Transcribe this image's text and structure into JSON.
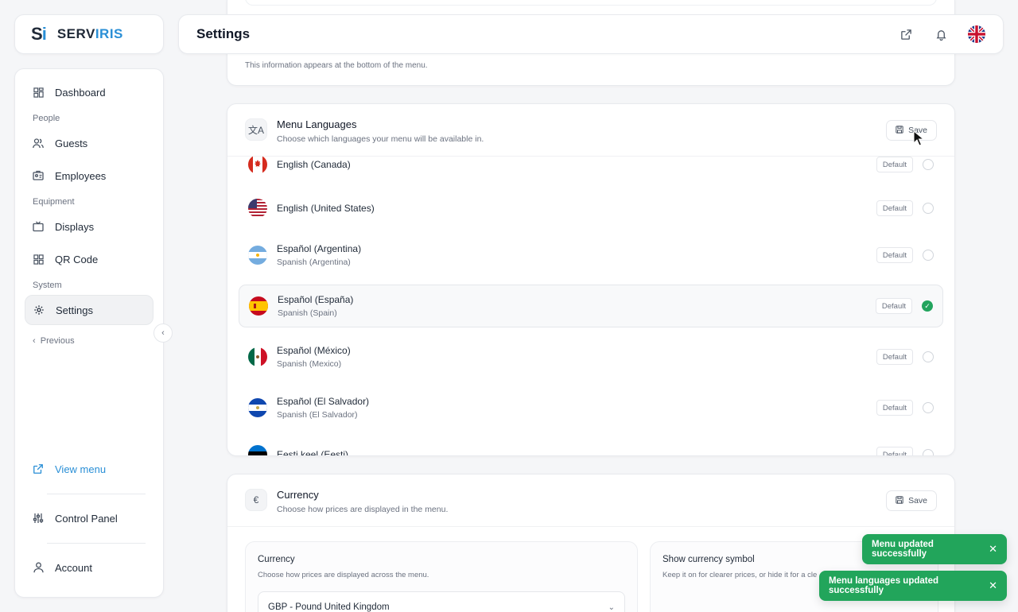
{
  "brand": {
    "mark_s": "S",
    "mark_i": "i",
    "name_part1": "SERV",
    "name_part2": "IRIS"
  },
  "header": {
    "title": "Settings"
  },
  "sidebar": {
    "items": [
      {
        "label": "Dashboard",
        "icon": "dashboard-icon"
      },
      {
        "section": "People"
      },
      {
        "label": "Guests",
        "icon": "guests-icon"
      },
      {
        "label": "Employees",
        "icon": "employees-icon"
      },
      {
        "section": "Equipment"
      },
      {
        "label": "Displays",
        "icon": "displays-icon"
      },
      {
        "label": "QR Code",
        "icon": "qr-code-icon"
      },
      {
        "section": "System"
      },
      {
        "label": "Settings",
        "icon": "gear-icon",
        "active": true
      }
    ],
    "previous": "Previous",
    "bottom": {
      "view_menu": "View menu",
      "control_panel": "Control Panel",
      "account": "Account"
    }
  },
  "info_card": {
    "note": "This information appears at the bottom of the menu."
  },
  "languages": {
    "icon_glyph": "文A",
    "title": "Menu Languages",
    "subtitle": "Choose which languages your menu will be available in.",
    "save_label": "Save",
    "default_label": "Default",
    "rows": [
      {
        "name": "English (Canada)",
        "sub": "",
        "flag": "ca",
        "selected": false
      },
      {
        "name": "English (United States)",
        "sub": "",
        "flag": "us",
        "selected": false
      },
      {
        "name": "Español (Argentina)",
        "sub": "Spanish (Argentina)",
        "flag": "ar",
        "selected": false
      },
      {
        "name": "Español (España)",
        "sub": "Spanish (Spain)",
        "flag": "es",
        "selected": true
      },
      {
        "name": "Español (México)",
        "sub": "Spanish (Mexico)",
        "flag": "mx",
        "selected": false
      },
      {
        "name": "Español (El Salvador)",
        "sub": "Spanish (El Salvador)",
        "flag": "sv",
        "selected": false
      },
      {
        "name": "Eesti keel (Eesti)",
        "sub": "",
        "flag": "ee",
        "selected": false
      }
    ]
  },
  "currency": {
    "icon_glyph": "€",
    "title": "Currency",
    "subtitle": "Choose how prices are displayed in the menu.",
    "save_label": "Save",
    "panel_currency": {
      "title": "Currency",
      "desc": "Choose how prices are displayed across the menu.",
      "selected": "GBP - Pound United Kingdom"
    },
    "panel_symbol": {
      "title": "Show currency symbol",
      "desc": "Keep it on for clearer prices, or hide it for a cle"
    }
  },
  "toasts": [
    {
      "text": "Menu updated successfully"
    },
    {
      "text": "Menu languages updated successfully"
    }
  ],
  "colors": {
    "accent": "#2a8fd6",
    "success": "#22a55b"
  }
}
